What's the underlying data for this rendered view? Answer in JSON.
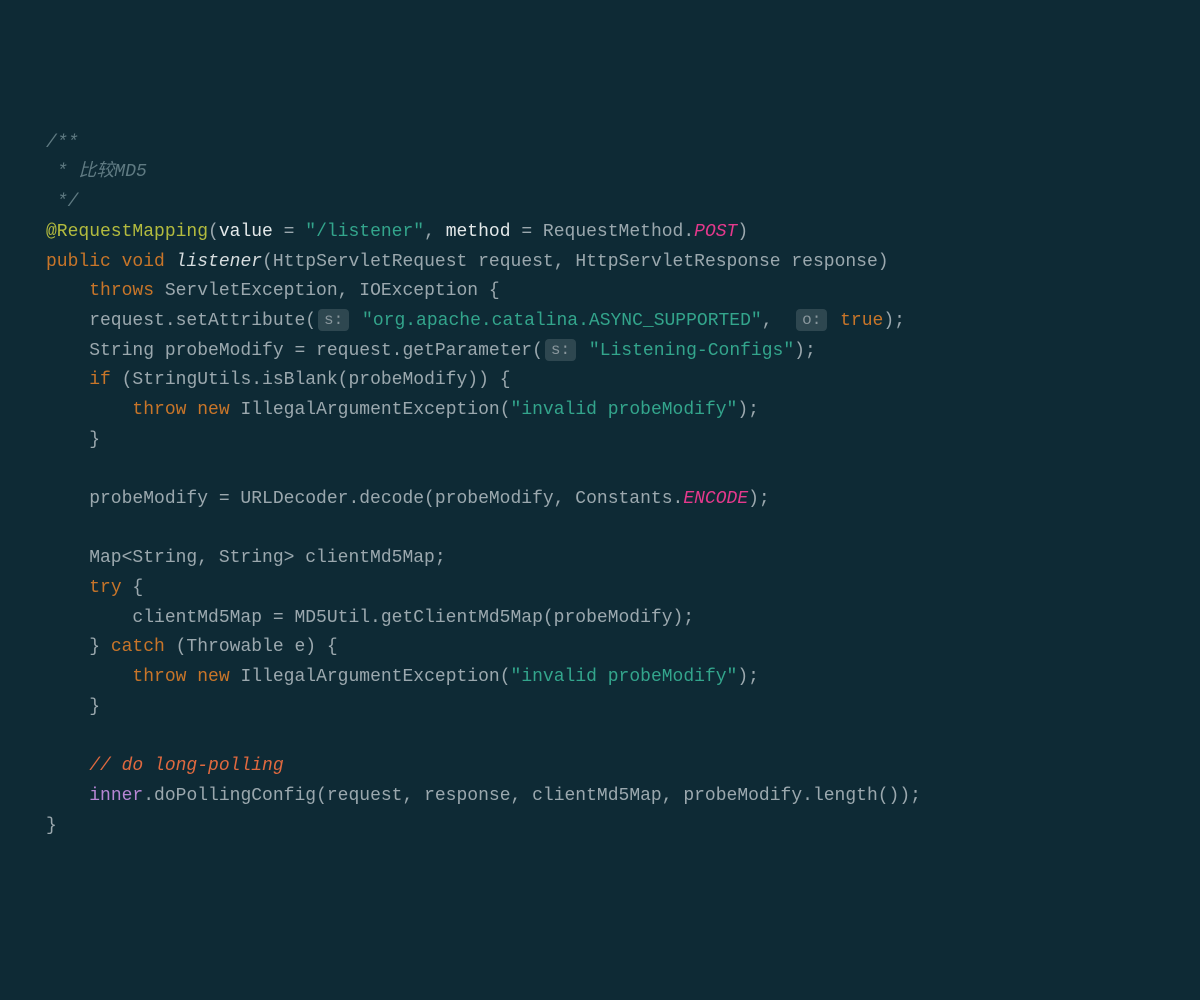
{
  "line1": "/**",
  "line2_star": " * ",
  "line2_txt": "比较MD5",
  "line3": " */",
  "l4_anno": "@RequestMapping",
  "l4_p1": "(",
  "l4_value": "value",
  "l4_eq1": " = ",
  "l4_str1": "\"/listener\"",
  "l4_comma": ", ",
  "l4_method": "method",
  "l4_eq2": " = ",
  "l4_rm": "RequestMethod.",
  "l4_post": "POST",
  "l4_p2": ")",
  "l5_public": "public",
  "l5_void": "void",
  "l5_name": "listener",
  "l5_sig": "(HttpServletRequest request, HttpServletResponse response)",
  "l6_throws": "throws",
  "l6_rest": " ServletException, IOException {",
  "l7_a": "    request.setAttribute(",
  "l7_hint": "s:",
  "l7_str": " \"org.apache.catalina.ASYNC_SUPPORTED\"",
  "l7_comma": ",  ",
  "l7_hint2": "o:",
  "l7_true": " true",
  "l7_end": ");",
  "l8_a": "    String probeModify = request.getParameter(",
  "l8_hint": "s:",
  "l8_str": " \"Listening-Configs\"",
  "l8_end": ");",
  "l9_if": "if",
  "l9_rest": " (StringUtils.isBlank(probeModify)) {",
  "l10_throw": "throw",
  "l10_new": "new",
  "l10_cls": " IllegalArgumentException(",
  "l10_str": "\"invalid probeModify\"",
  "l10_end": ");",
  "l11": "    }",
  "l13_a": "    probeModify = URLDecoder.decode(probeModify, Constants.",
  "l13_enc": "ENCODE",
  "l13_end": ");",
  "l15": "    Map<String, String> clientMd5Map;",
  "l16_try": "try",
  "l16_rest": " {",
  "l17": "        clientMd5Map = MD5Util.getClientMd5Map(probeModify);",
  "l18_a": "    } ",
  "l18_catch": "catch",
  "l18_rest": " (Throwable e) {",
  "l19_throw": "throw",
  "l19_new": "new",
  "l19_cls": " IllegalArgumentException(",
  "l19_str": "\"invalid probeModify\"",
  "l19_end": ");",
  "l20": "    }",
  "l22": "// do long-polling",
  "l23_inner": "inner",
  "l23_rest": ".doPollingConfig(request, response, clientMd5Map, probeModify.length());",
  "l24": "}"
}
